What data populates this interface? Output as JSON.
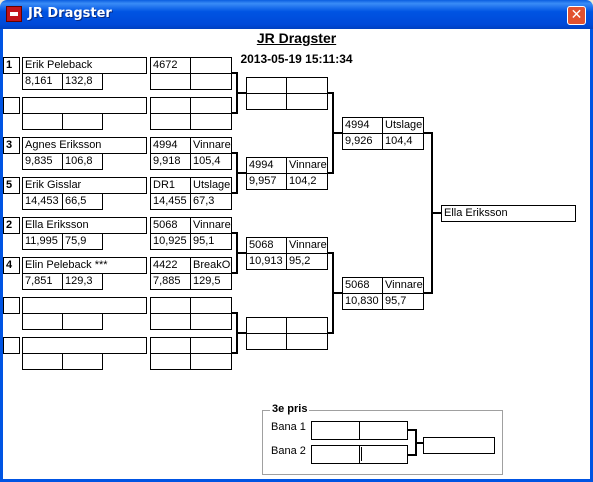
{
  "window": {
    "title": "JR Dragster",
    "close_glyph": "✕"
  },
  "header": {
    "title": "JR Dragster",
    "datetime": "2013-05-19 15:11:34"
  },
  "round1": [
    {
      "seed": "1",
      "name": "Erik Peleback",
      "time": "8,161",
      "speed": "132,8"
    },
    {
      "seed": "",
      "name": "",
      "time": "",
      "speed": ""
    },
    {
      "seed": "3",
      "name": "Agnes Eriksson",
      "time": "9,835",
      "speed": "106,8"
    },
    {
      "seed": "5",
      "name": "Erik Gisslar",
      "time": "14,453",
      "speed": "66,5"
    },
    {
      "seed": "2",
      "name": "Ella Eriksson",
      "time": "11,995",
      "speed": "75,9"
    },
    {
      "seed": "4",
      "name": "Elin Peleback ***",
      "time": "7,851",
      "speed": "129,3"
    },
    {
      "seed": "",
      "name": "",
      "time": "",
      "speed": ""
    },
    {
      "seed": "",
      "name": "",
      "time": "",
      "speed": ""
    }
  ],
  "round2": [
    {
      "id": "4672",
      "status": "",
      "time": "",
      "speed": ""
    },
    {
      "id": "",
      "status": "",
      "time": "",
      "speed": ""
    },
    {
      "id": "4994",
      "status": "Vinnare",
      "time": "9,918",
      "speed": "105,4"
    },
    {
      "id": "DR1",
      "status": "Utslagen",
      "time": "14,455",
      "speed": "67,3"
    },
    {
      "id": "5068",
      "status": "Vinnare",
      "time": "10,925",
      "speed": "95,1"
    },
    {
      "id": "4422",
      "status": "BreakOut",
      "time": "7,885",
      "speed": "129,5"
    },
    {
      "id": "",
      "status": "",
      "time": "",
      "speed": ""
    },
    {
      "id": "",
      "status": "",
      "time": "",
      "speed": ""
    }
  ],
  "round3": [
    {
      "id": "",
      "status": "",
      "time": "",
      "speed": ""
    },
    {
      "id": "4994",
      "status": "Vinnare",
      "time": "9,957",
      "speed": "104,2"
    },
    {
      "id": "5068",
      "status": "Vinnare",
      "time": "10,913",
      "speed": "95,2"
    },
    {
      "id": "",
      "status": "",
      "time": "",
      "speed": ""
    }
  ],
  "semis": [
    {
      "id": "4994",
      "status": "Utslagen",
      "time": "9,926",
      "speed": "104,4"
    },
    {
      "id": "5068",
      "status": "Vinnare",
      "time": "10,830",
      "speed": "95,7"
    }
  ],
  "winner": "Ella Eriksson",
  "third_prize": {
    "title": "3e pris",
    "lane1": "Bana 1",
    "lane2": "Bana 2"
  }
}
